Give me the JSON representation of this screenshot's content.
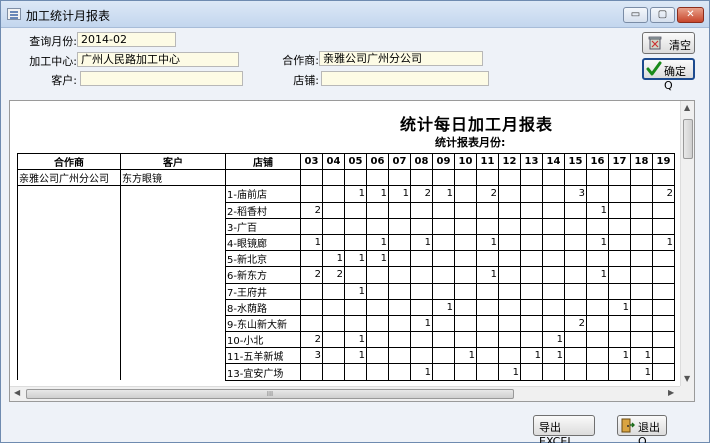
{
  "window": {
    "title": "加工统计月报表",
    "min_glyph": "▭",
    "max_glyph": "▢",
    "close_glyph": "✕"
  },
  "form": {
    "month_label": "查询月份:",
    "month_value": "2014-02",
    "center_label": "加工中心:",
    "center_value": "广州人民路加工中心",
    "partner_label": "合作商:",
    "partner_value": "亲雅公司广州分公司",
    "customer_label": "客户:",
    "customer_value": "",
    "store_label": "店铺:",
    "store_value": ""
  },
  "buttons": {
    "clear": "清空",
    "confirm": "确定Q",
    "export": "导出EXCEL",
    "exit": "退出Q"
  },
  "report": {
    "title": "统计每日加工月报表",
    "subtitle": "统计报表月份:",
    "columns": [
      "合作商",
      "客户",
      "店铺",
      "03",
      "04",
      "05",
      "06",
      "07",
      "08",
      "09",
      "10",
      "11",
      "12",
      "13",
      "14",
      "15",
      "16",
      "17",
      "18",
      "19"
    ],
    "first_row": {
      "partner": "亲雅公司广州分公司",
      "customer": "东方眼镜"
    },
    "rows": [
      {
        "store": "1-庙前店",
        "counts": [
          "",
          "",
          "1",
          "1",
          "1",
          "2",
          "1",
          "",
          "2",
          "",
          "",
          "",
          "3",
          "",
          "",
          "",
          "2"
        ]
      },
      {
        "store": "2-稻香村",
        "counts": [
          "2",
          "",
          "",
          "",
          "",
          "",
          "",
          "",
          "",
          "",
          "",
          "",
          "",
          "1",
          "",
          "",
          ""
        ]
      },
      {
        "store": "3-广百",
        "counts": [
          "",
          "",
          "",
          "",
          "",
          "",
          "",
          "",
          "",
          "",
          "",
          "",
          "",
          "",
          "",
          "",
          ""
        ]
      },
      {
        "store": "4-眼镜廊",
        "counts": [
          "1",
          "",
          "",
          "1",
          "",
          "1",
          "",
          "",
          "1",
          "",
          "",
          "",
          "",
          "1",
          "",
          "",
          "1"
        ]
      },
      {
        "store": "5-新北京",
        "counts": [
          "",
          "1",
          "1",
          "1",
          "",
          "",
          "",
          "",
          "",
          "",
          "",
          "",
          "",
          "",
          "",
          "",
          ""
        ]
      },
      {
        "store": "6-新东方",
        "counts": [
          "2",
          "2",
          "",
          "",
          "",
          "",
          "",
          "",
          "1",
          "",
          "",
          "",
          "",
          "1",
          "",
          "",
          ""
        ]
      },
      {
        "store": "7-王府井",
        "counts": [
          "",
          "",
          "1",
          "",
          "",
          "",
          "",
          "",
          "",
          "",
          "",
          "",
          "",
          "",
          "",
          "",
          ""
        ]
      },
      {
        "store": "8-水荫路",
        "counts": [
          "",
          "",
          "",
          "",
          "",
          "",
          "1",
          "",
          "",
          "",
          "",
          "",
          "",
          "",
          "1",
          "",
          ""
        ]
      },
      {
        "store": "9-东山新大新",
        "counts": [
          "",
          "",
          "",
          "",
          "",
          "1",
          "",
          "",
          "",
          "",
          "",
          "",
          "2",
          "",
          "",
          "",
          ""
        ]
      },
      {
        "store": "10-小北",
        "counts": [
          "2",
          "",
          "1",
          "",
          "",
          "",
          "",
          "",
          "",
          "",
          "",
          "1",
          "",
          "",
          "",
          "",
          ""
        ]
      },
      {
        "store": "11-五羊新城",
        "counts": [
          "3",
          "",
          "1",
          "",
          "",
          "",
          "",
          "1",
          "",
          "",
          "1",
          "1",
          "",
          "",
          "1",
          "1",
          ""
        ]
      },
      {
        "store": "13-宜安广场",
        "counts": [
          "",
          "",
          "",
          "",
          "",
          "1",
          "",
          "",
          "",
          "1",
          "",
          "",
          "",
          "",
          "",
          "1",
          ""
        ]
      }
    ]
  },
  "scroll": {
    "up": "▲",
    "down": "▼",
    "left": "◀",
    "right": "▶",
    "grip": "III"
  }
}
